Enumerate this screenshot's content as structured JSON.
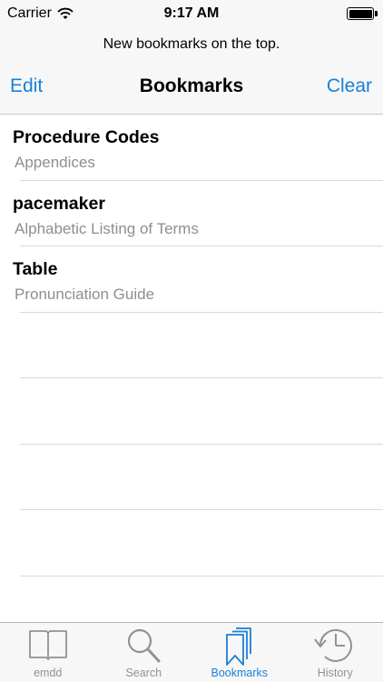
{
  "status_bar": {
    "carrier": "Carrier",
    "time": "9:17 AM"
  },
  "header": {
    "prompt": "New bookmarks on the top.",
    "title": "Bookmarks",
    "edit_label": "Edit",
    "clear_label": "Clear"
  },
  "bookmarks": [
    {
      "title": "Procedure Codes",
      "subtitle": "Appendices"
    },
    {
      "title": "pacemaker",
      "subtitle": "Alphabetic Listing of Terms"
    },
    {
      "title": "Table",
      "subtitle": "Pronunciation Guide"
    }
  ],
  "tabs": [
    {
      "label": "emdd",
      "icon": "book-icon"
    },
    {
      "label": "Search",
      "icon": "magnifier-icon"
    },
    {
      "label": "Bookmarks",
      "icon": "bookmarks-icon",
      "active": true
    },
    {
      "label": "History",
      "icon": "clock-icon"
    }
  ],
  "colors": {
    "accent": "#1a7fd8",
    "inactive": "#929292",
    "secondary_text": "#8e8e93"
  }
}
